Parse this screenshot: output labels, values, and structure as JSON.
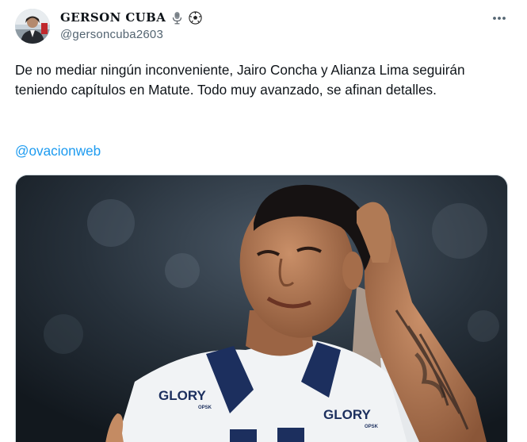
{
  "author": {
    "display_name": "GERSON CUBA",
    "handle": "@gersoncuba2603",
    "name_emojis": [
      "microphone-icon",
      "soccer-ball-icon"
    ]
  },
  "actions": {
    "more_label": "More"
  },
  "tweet": {
    "text": "De no mediar ningún inconveniente, Jairo Concha y Alianza Lima seguirán teniendo capítulos en Matute. Todo muy avanzado, se afinan detalles.",
    "mention": "@ovacionweb"
  },
  "media": {
    "jersey_brand_1": "GLORY",
    "jersey_sub_1": "OPSK",
    "jersey_brand_2": "GLORY",
    "jersey_sub_2": "OPSK"
  },
  "colors": {
    "link": "#1d9bf0",
    "text": "#0f1419",
    "secondary": "#536471"
  }
}
